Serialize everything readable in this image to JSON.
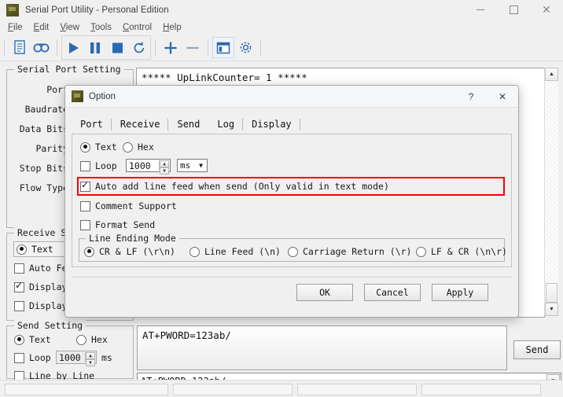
{
  "window": {
    "title": "Serial Port Utility - Personal Edition",
    "icon": "app-icon",
    "controls": {
      "minimize": "—",
      "maximize": "□",
      "close": "✕"
    }
  },
  "menubar": {
    "items": [
      {
        "mnemonic": "F",
        "rest": "ile"
      },
      {
        "mnemonic": "E",
        "rest": "dit"
      },
      {
        "mnemonic": "V",
        "rest": "iew"
      },
      {
        "mnemonic": "T",
        "rest": "ools"
      },
      {
        "mnemonic": "C",
        "rest": "ontrol"
      },
      {
        "mnemonic": "H",
        "rest": "elp"
      }
    ]
  },
  "toolbar": {
    "items": [
      {
        "name": "new-file-icon"
      },
      {
        "name": "record-icon"
      },
      {
        "name": "play-icon"
      },
      {
        "name": "pause-icon"
      },
      {
        "name": "stop-icon"
      },
      {
        "name": "refresh-icon"
      },
      {
        "name": "add-icon"
      },
      {
        "name": "remove-icon"
      },
      {
        "name": "layout-icon"
      },
      {
        "name": "settings-gear-icon"
      }
    ]
  },
  "serial_port_setting": {
    "legend": "Serial Port Setting",
    "labels": [
      "Port",
      "Baudrate",
      "Data Bits",
      "Parity",
      "Stop Bits",
      "Flow Type"
    ]
  },
  "receive_setting": {
    "legend": "Receive Setting",
    "mode_text": "Text",
    "mode_text_selected": true,
    "options": [
      {
        "label": "Auto Fe",
        "checked": false
      },
      {
        "label": "Display",
        "checked": true
      },
      {
        "label": "Display",
        "checked": false
      }
    ]
  },
  "send_setting": {
    "legend": "Send Setting",
    "text_label": "Text",
    "hex_label": "Hex",
    "text_selected": true,
    "hex_selected": false,
    "loop_label": "Loop",
    "loop_checked": false,
    "loop_value": "1000",
    "loop_unit": "ms",
    "line_by_line_label": "Line by Line",
    "line_by_line_checked": false
  },
  "receive_area": {
    "text": "***** UpLinkCounter= 1 *****"
  },
  "send_area": {
    "text": "AT+PWORD=123ab/",
    "send_button": "Send",
    "combo_value": "AT+PWORD=123ab/"
  },
  "dialog": {
    "title": "Option",
    "icon": "app-icon",
    "help_glyph": "?",
    "close_glyph": "✕",
    "tabs": [
      {
        "label": "Port",
        "active": false
      },
      {
        "label": "Receive",
        "active": false
      },
      {
        "label": "Send",
        "active": true
      },
      {
        "label": "Log",
        "active": false
      },
      {
        "label": "Display",
        "active": false
      }
    ],
    "send_tab": {
      "text_label": "Text",
      "hex_label": "Hex",
      "text_selected": true,
      "hex_selected": false,
      "loop_label": "Loop",
      "loop_checked": false,
      "loop_value": "1000",
      "loop_unit": "ms",
      "auto_line_feed_label": "Auto add line feed when send (Only valid in text mode)",
      "auto_line_feed_checked": true,
      "auto_line_feed_highlight_color": "#ff0000",
      "comment_support_label": "Comment Support",
      "comment_support_checked": false,
      "format_send_label": "Format Send",
      "format_send_checked": false,
      "line_ending_legend": "Line Ending Mode",
      "line_ending_options": [
        {
          "label": "CR & LF (\\r\\n)",
          "selected": true
        },
        {
          "label": "Line Feed (\\n)",
          "selected": false
        },
        {
          "label": "Carriage Return (\\r)",
          "selected": false
        },
        {
          "label": "LF & CR (\\n\\r)",
          "selected": false
        }
      ]
    },
    "buttons": {
      "ok": "OK",
      "cancel": "Cancel",
      "apply": "Apply"
    }
  },
  "colors": {
    "accent_blue": "#2a6ab0",
    "window_bg": "#f0f0f0",
    "highlight_red": "#ff0000"
  }
}
